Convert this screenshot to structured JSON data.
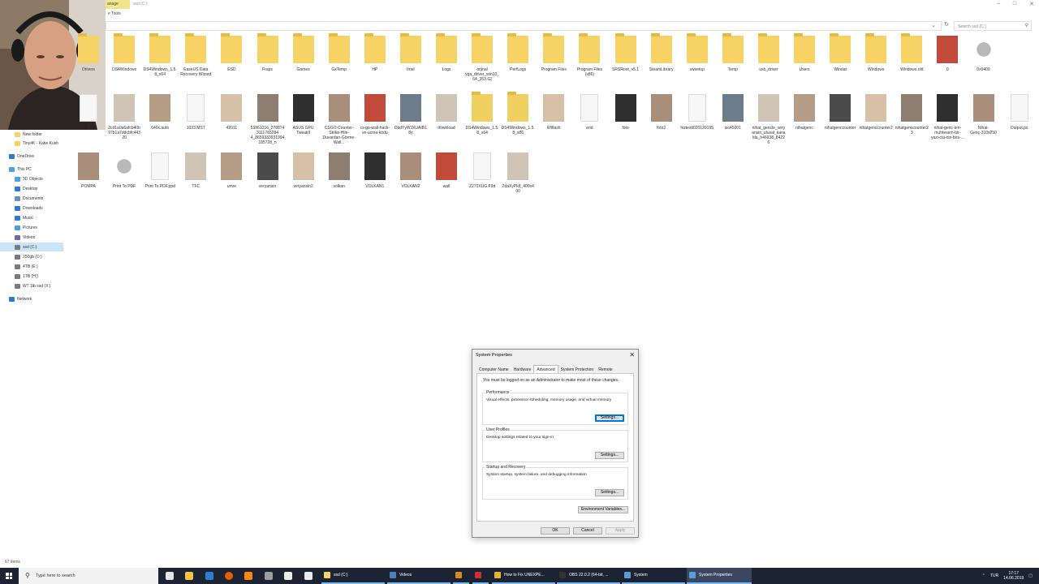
{
  "titlebar": {
    "manage_label": "anage",
    "title": "ssd (C:)",
    "drive_tools": "e Tools"
  },
  "search": {
    "placeholder": "Search ssd (C:)"
  },
  "nav": [
    {
      "label": "New folder",
      "icon": "folder-icon",
      "indent": 1,
      "selected": false
    },
    {
      "label": "Tiny4K - Katie Kush",
      "icon": "folder-icon",
      "indent": 1,
      "selected": false
    },
    {
      "label": "OneDrive",
      "icon": "onedrive-icon",
      "indent": 0,
      "selected": false
    },
    {
      "label": "This PC",
      "icon": "pc-icon",
      "indent": 0,
      "selected": false
    },
    {
      "label": "3D Objects",
      "icon": "3d-objects-icon",
      "indent": 1,
      "selected": false
    },
    {
      "label": "Desktop",
      "icon": "desktop-icon",
      "indent": 1,
      "selected": false
    },
    {
      "label": "Documents",
      "icon": "documents-icon",
      "indent": 1,
      "selected": false
    },
    {
      "label": "Downloads",
      "icon": "downloads-icon",
      "indent": 1,
      "selected": false
    },
    {
      "label": "Music",
      "icon": "music-icon",
      "indent": 1,
      "selected": false
    },
    {
      "label": "Pictures",
      "icon": "pictures-icon",
      "indent": 1,
      "selected": false
    },
    {
      "label": "Videos",
      "icon": "videos-icon",
      "indent": 1,
      "selected": false
    },
    {
      "label": "ssd (C:)",
      "icon": "drive-icon",
      "indent": 1,
      "selected": true
    },
    {
      "label": "250gb (D:)",
      "icon": "drive-icon",
      "indent": 1,
      "selected": false
    },
    {
      "label": "4TB (E:)",
      "icon": "drive-icon",
      "indent": 1,
      "selected": false
    },
    {
      "label": "1TB (H:)",
      "icon": "drive-icon",
      "indent": 1,
      "selected": false
    },
    {
      "label": "W7 1tb ssd (X:)",
      "icon": "drive-icon",
      "indent": 1,
      "selected": false
    },
    {
      "label": "Network",
      "icon": "network-icon",
      "indent": 0,
      "selected": false
    }
  ],
  "files": [
    [
      {
        "label": "Drivers",
        "kind": "folder"
      },
      {
        "label": "DS4Windows",
        "kind": "folder"
      },
      {
        "label": "DS4Windows_1.5.8_x64",
        "kind": "folder"
      },
      {
        "label": "EaseUS Data Recovery Wizard",
        "kind": "folder"
      },
      {
        "label": "ESD",
        "kind": "folder"
      },
      {
        "label": "Fraps",
        "kind": "folder"
      },
      {
        "label": "Games",
        "kind": "folder"
      },
      {
        "label": "GxTemp",
        "kind": "folder"
      },
      {
        "label": "HP",
        "kind": "folder"
      },
      {
        "label": "Intel",
        "kind": "folder"
      },
      {
        "label": "Logs",
        "kind": "folder"
      },
      {
        "label": "orjinal vga_driver_win10_64_353.62",
        "kind": "folder"
      },
      {
        "label": "PerfLogs",
        "kind": "folder"
      },
      {
        "label": "Program Files",
        "kind": "folder"
      },
      {
        "label": "Program Files (x86)",
        "kind": "folder"
      },
      {
        "label": "SRSRoot_v5.1",
        "kind": "folder"
      },
      {
        "label": "SteamLibrary",
        "kind": "folder"
      },
      {
        "label": "swsetup",
        "kind": "folder"
      },
      {
        "label": "Temp",
        "kind": "folder"
      },
      {
        "label": "usb_driver",
        "kind": "folder"
      },
      {
        "label": "Users",
        "kind": "folder"
      },
      {
        "label": "Windat",
        "kind": "folder"
      },
      {
        "label": "Windows",
        "kind": "folder"
      },
      {
        "label": "Windows.old",
        "kind": "folder"
      },
      {
        "label": "0",
        "kind": "img"
      },
      {
        "label": "0x0409",
        "kind": "gear"
      }
    ],
    [
      {
        "label": "3",
        "kind": "doc"
      },
      {
        "label": "2cd1a0a6afcb40b97b1a7ddcbfc44320",
        "kind": "img"
      },
      {
        "label": "640x.auto",
        "kind": "img"
      },
      {
        "label": "1033.MST",
        "kind": "doc"
      },
      {
        "label": "42011",
        "kind": "img"
      },
      {
        "label": "53861016_2788743111783284 4_8659333931994185728_n",
        "kind": "img"
      },
      {
        "label": "ASUS GPU TweakII",
        "kind": "img"
      },
      {
        "label": "CSGO-Counter-Strike-Hile-Duvardan-Görme-Wall...",
        "kind": "img"
      },
      {
        "label": "cs-go-wall-hack-ve-ucma-kodu",
        "kind": "img"
      },
      {
        "label": "DbdYyWJXUAIB18y",
        "kind": "img"
      },
      {
        "label": "download",
        "kind": "img"
      },
      {
        "label": "DS4Windows_1.5.8_x64",
        "kind": "zip"
      },
      {
        "label": "DS4Windows_1.5.8_x86",
        "kind": "zip"
      },
      {
        "label": "Efiflash",
        "kind": "img"
      },
      {
        "label": "end",
        "kind": "doc"
      },
      {
        "label": "foto",
        "kind": "img"
      },
      {
        "label": "foto2",
        "kind": "img"
      },
      {
        "label": "hiztesti020120195",
        "kind": "doc"
      },
      {
        "label": "iso45001",
        "kind": "img"
      },
      {
        "label": "nihat_gencle_veryansin_ulusal_kanalda_h46938_84226",
        "kind": "img"
      },
      {
        "label": "nihatgenc",
        "kind": "img"
      },
      {
        "label": "nihatgenccounter",
        "kind": "img"
      },
      {
        "label": "nihatgenccounter2",
        "kind": "img"
      },
      {
        "label": "nihatgenccounter23",
        "kind": "img"
      },
      {
        "label": "nihat-genc-ten-muhtesem-bir-yazi-cia-nin-bos-...",
        "kind": "img"
      },
      {
        "label": "Nihat-Genç-310x250",
        "kind": "img"
      },
      {
        "label": "Output.ps",
        "kind": "doc"
      }
    ],
    [
      {
        "label": "POMPA",
        "kind": "img"
      },
      {
        "label": "Print To PDF",
        "kind": "gear"
      },
      {
        "label": "Print To PDF.ppd",
        "kind": "doc"
      },
      {
        "label": "TFC",
        "kind": "img"
      },
      {
        "label": "umre",
        "kind": "img"
      },
      {
        "label": "veryansin",
        "kind": "img"
      },
      {
        "label": "veryansin2",
        "kind": "img"
      },
      {
        "label": "volkan",
        "kind": "img"
      },
      {
        "label": "VOLKAN1",
        "kind": "img"
      },
      {
        "label": "VOLKAN2",
        "kind": "img"
      },
      {
        "label": "wall",
        "kind": "img"
      },
      {
        "label": "Z270XUG.F9d",
        "kind": "doc"
      },
      {
        "label": "ZdaXyPk8_400x400",
        "kind": "img"
      }
    ]
  ],
  "status": {
    "item_count": "67 items"
  },
  "dialog": {
    "title": "System Properties",
    "tabs": [
      "Computer Name",
      "Hardware",
      "Advanced",
      "System Protection",
      "Remote"
    ],
    "active_tab": "Advanced",
    "admin_note": "You must be logged on as an Administrator to make most of these changes.",
    "performance": {
      "label": "Performance",
      "desc": "Visual effects, processor scheduling, memory usage, and virtual memory",
      "button": "Settings..."
    },
    "user_profiles": {
      "label": "User Profiles",
      "desc": "Desktop settings related to your sign-in",
      "button": "Settings..."
    },
    "startup": {
      "label": "Startup and Recovery",
      "desc": "System startup, system failure, and debugging information",
      "button": "Settings..."
    },
    "env_button": "Environment Variables...",
    "ok": "OK",
    "cancel": "Cancel",
    "apply": "Apply"
  },
  "taskbar": {
    "search_text": "Type here to search",
    "apps": [
      {
        "label": "ssd (C:)",
        "icon": "explorer-icon",
        "color": "#f7d366",
        "active": false
      },
      {
        "label": "Videos",
        "icon": "videos-icon",
        "color": "#4d7ebd",
        "active": false
      },
      {
        "label": "",
        "icon": "app-icon",
        "color": "#d98a19",
        "active": false
      },
      {
        "label": "",
        "icon": "opera-icon",
        "color": "#d32f2f",
        "active": false
      },
      {
        "label": "How to Fix UNEXPE...",
        "icon": "chrome-icon",
        "color": "#e8b62a",
        "active": false
      },
      {
        "label": "OBS 22.0.2 (64-bit, ...",
        "icon": "obs-icon",
        "color": "#333333",
        "active": false
      },
      {
        "label": "System",
        "icon": "system-icon",
        "color": "#5a9bd8",
        "active": false
      },
      {
        "label": "System Properties",
        "icon": "system-icon",
        "color": "#5a9bd8",
        "active": true
      }
    ],
    "tray_lang": "TUR",
    "time": "17:17",
    "date": "14.06.2019"
  },
  "colors": {
    "accent": "#0078d7",
    "taskbar": "#1c2433",
    "folder": "#f7d366",
    "selection": "#cce4f7"
  }
}
